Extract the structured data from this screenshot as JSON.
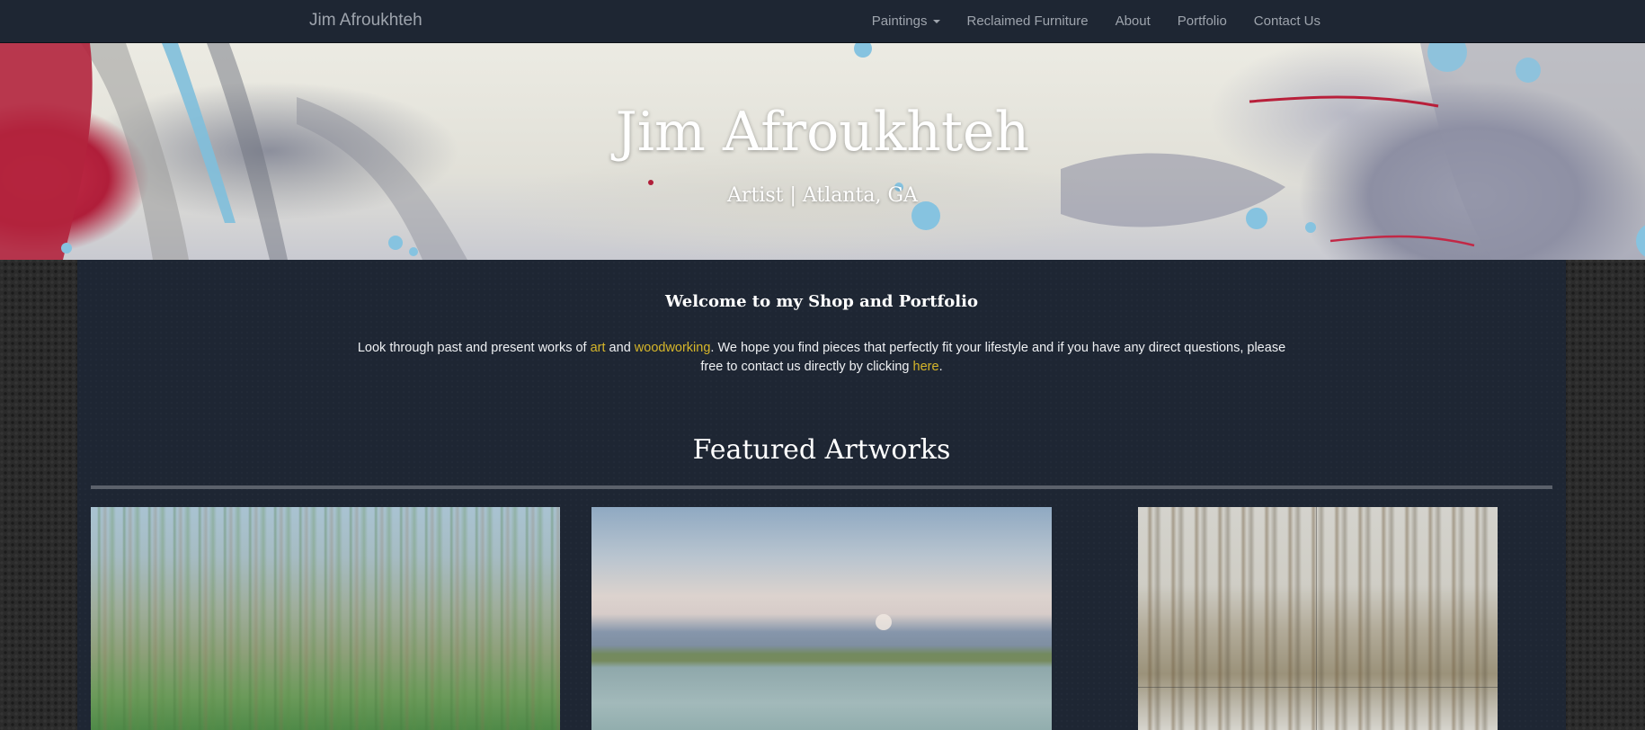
{
  "navbar": {
    "brand": "Jim Afroukhteh",
    "links": [
      {
        "label": "Paintings",
        "has_dropdown": true
      },
      {
        "label": "Reclaimed Furniture"
      },
      {
        "label": "About"
      },
      {
        "label": "Portfolio"
      },
      {
        "label": "Contact Us"
      }
    ]
  },
  "hero": {
    "title": "Jim Afroukhteh",
    "subtitle": "Artist | Atlanta, GA"
  },
  "welcome": {
    "heading": "Welcome to my Shop and Portfolio",
    "text_1": "Look through past and present works of ",
    "link_art": "art",
    "text_2": " and ",
    "link_woodworking": "woodworking",
    "text_3": ". We hope you find pieces that perfectly fit your lifestyle and if you have any direct questions, please free to contact us directly by clicking ",
    "link_here": "here",
    "text_4": "."
  },
  "featured": {
    "heading": "Featured Artworks"
  },
  "colors": {
    "navbar_bg": "#1e2633",
    "nav_text": "#9ea4ad",
    "link_accent": "#d6b62a",
    "panel_bg": "#1e2633"
  }
}
